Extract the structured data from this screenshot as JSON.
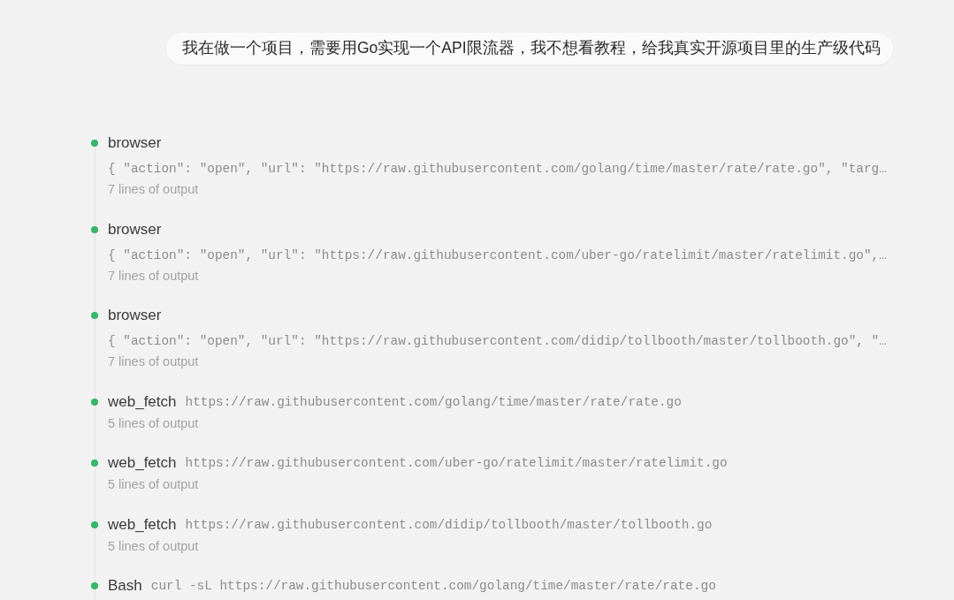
{
  "user_message": {
    "text": "我在做一个项目，需要用Go实现一个API限流器，我不想看教程，给我真实开源项目里的生产级代码"
  },
  "steps": [
    {
      "kind": "expanded",
      "completed": true,
      "tool": "browser",
      "argument": "{ \"action\": \"open\", \"url\": \"https://raw.githubusercontent.com/golang/time/master/rate/rate.go\", \"targ…",
      "output": "7 lines of output"
    },
    {
      "kind": "expanded",
      "completed": true,
      "tool": "browser",
      "argument": "{ \"action\": \"open\", \"url\": \"https://raw.githubusercontent.com/uber-go/ratelimit/master/ratelimit.go\",…",
      "output": "7 lines of output"
    },
    {
      "kind": "expanded",
      "completed": true,
      "tool": "browser",
      "argument": "{ \"action\": \"open\", \"url\": \"https://raw.githubusercontent.com/didip/tollbooth/master/tollbooth.go\", \"…",
      "output": "7 lines of output"
    },
    {
      "kind": "inline",
      "completed": true,
      "tool": "web_fetch",
      "argument": "https://raw.githubusercontent.com/golang/time/master/rate/rate.go",
      "output": "5 lines of output"
    },
    {
      "kind": "inline",
      "completed": true,
      "tool": "web_fetch",
      "argument": "https://raw.githubusercontent.com/uber-go/ratelimit/master/ratelimit.go",
      "output": "5 lines of output"
    },
    {
      "kind": "inline",
      "completed": true,
      "tool": "web_fetch",
      "argument": "https://raw.githubusercontent.com/didip/tollbooth/master/tollbooth.go",
      "output": "5 lines of output"
    },
    {
      "kind": "inline",
      "completed": true,
      "tool": "Bash",
      "argument": "curl -sL https://raw.githubusercontent.com/golang/time/master/rate/rate.go"
    }
  ]
}
